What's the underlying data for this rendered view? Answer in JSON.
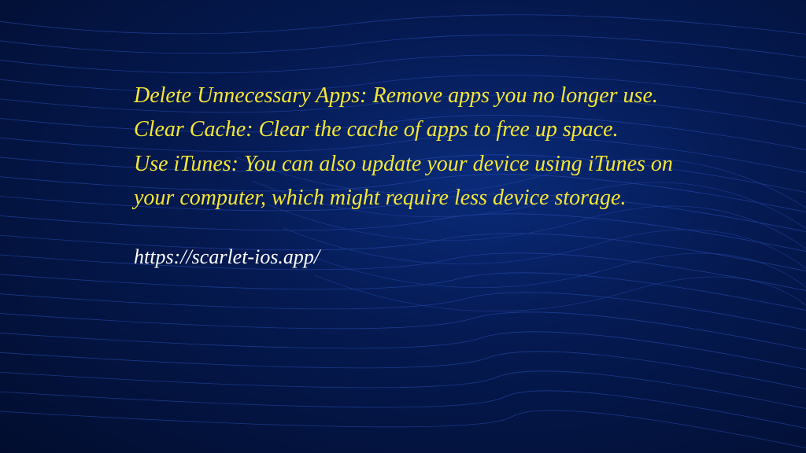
{
  "tips": [
    {
      "title": "Delete Unnecessary Apps:",
      "body": "Remove apps you no longer use."
    },
    {
      "title": "Clear Cache:",
      "body": "Clear the cache of apps to free up space."
    },
    {
      "title": "Use iTunes:",
      "body": "You can also update your device using iTunes on your computer, which might require less device storage."
    }
  ],
  "url": "https://scarlet-ios.app/",
  "colors": {
    "text": "#f5e733",
    "url": "#ffffff"
  }
}
